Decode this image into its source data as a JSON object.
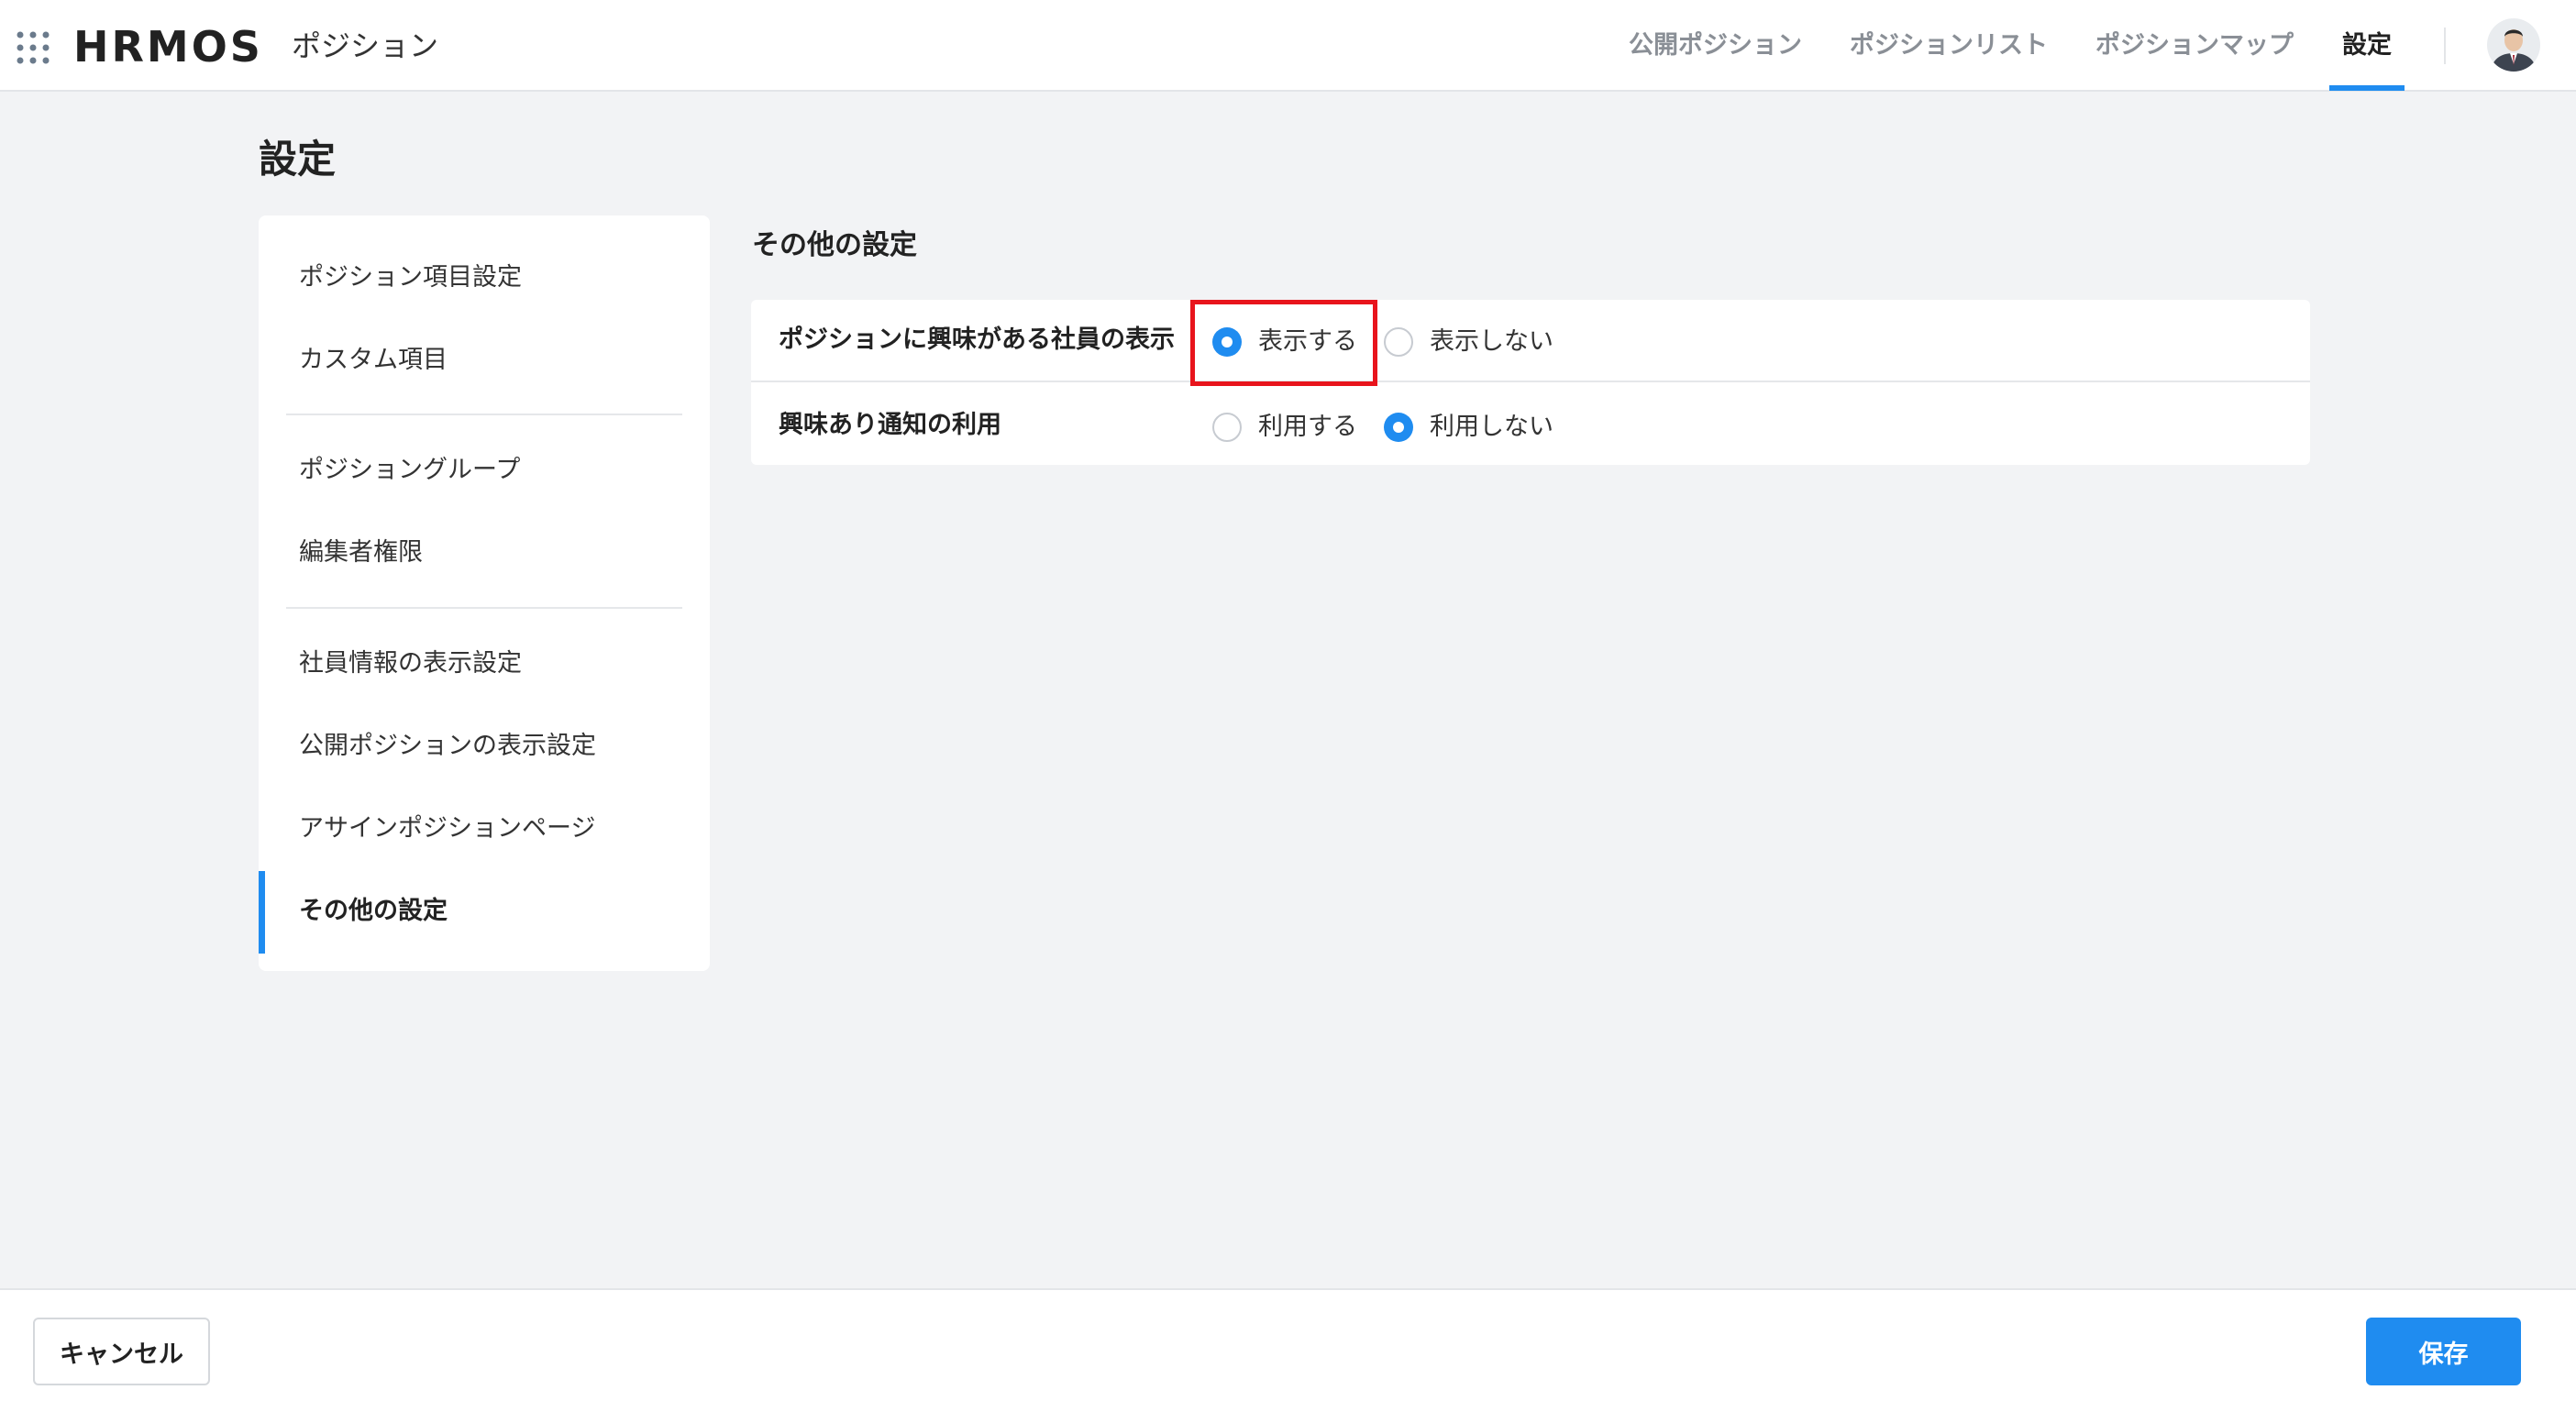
{
  "header": {
    "logo_text": "HRMOS",
    "product_name": "ポジション",
    "nav": [
      {
        "label": "公開ポジション",
        "active": false
      },
      {
        "label": "ポジションリスト",
        "active": false
      },
      {
        "label": "ポジションマップ",
        "active": false
      },
      {
        "label": "設定",
        "active": true
      }
    ]
  },
  "page": {
    "title": "設定"
  },
  "sidebar": {
    "groups": [
      [
        "ポジション項目設定",
        "カスタム項目"
      ],
      [
        "ポジショングループ",
        "編集者権限"
      ],
      [
        "社員情報の表示設定",
        "公開ポジションの表示設定",
        "アサインポジションページ",
        "その他の設定"
      ]
    ],
    "items": [
      {
        "label": "ポジション項目設定"
      },
      {
        "label": "カスタム項目"
      },
      {
        "label": "ポジショングループ"
      },
      {
        "label": "編集者権限"
      },
      {
        "label": "社員情報の表示設定"
      },
      {
        "label": "公開ポジションの表示設定"
      },
      {
        "label": "アサインポジションページ"
      },
      {
        "label": "その他の設定",
        "active": true
      }
    ]
  },
  "main": {
    "section_title": "その他の設定",
    "rows": [
      {
        "label": "ポジションに興味がある社員の表示",
        "options": [
          {
            "label": "表示する",
            "checked": true
          },
          {
            "label": "表示しない",
            "checked": false
          }
        ]
      },
      {
        "label": "興味あり通知の利用",
        "options": [
          {
            "label": "利用する",
            "checked": false
          },
          {
            "label": "利用しない",
            "checked": true
          }
        ]
      }
    ]
  },
  "footer": {
    "cancel_label": "キャンセル",
    "save_label": "保存"
  },
  "colors": {
    "accent": "#1f8cf0",
    "highlight": "#e8141c",
    "background": "#f2f3f5"
  }
}
